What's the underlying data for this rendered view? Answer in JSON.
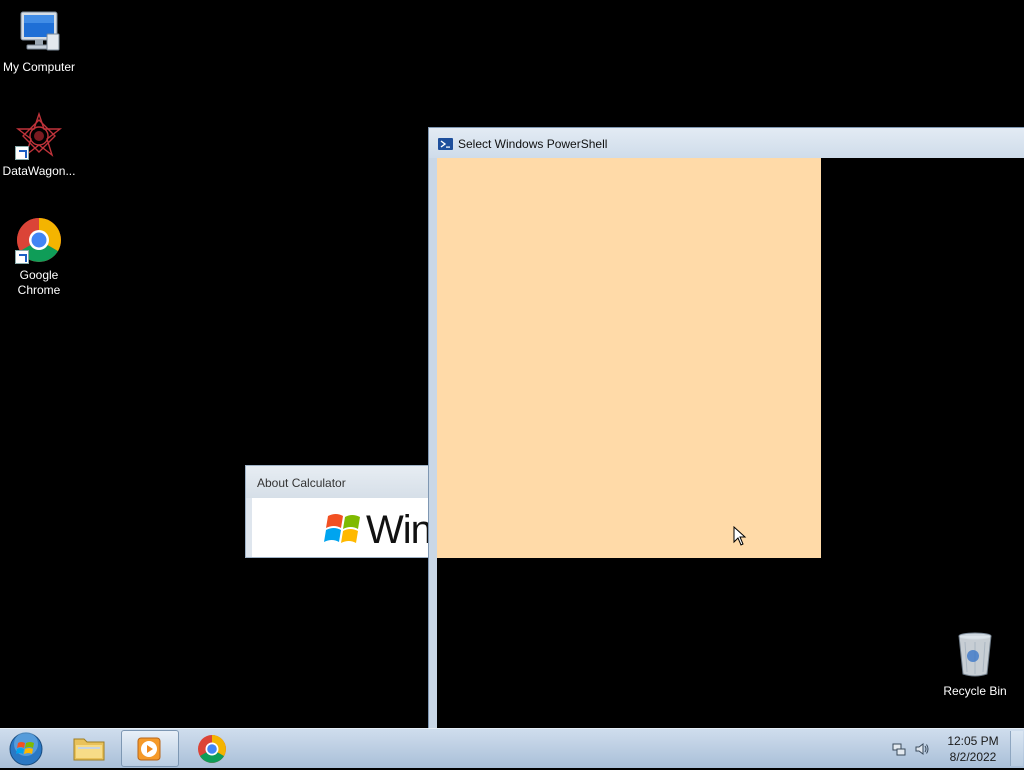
{
  "desktop": {
    "icons": [
      {
        "label": "My Computer",
        "icon": "computer-icon"
      },
      {
        "label": "DataWagon...",
        "icon": "datawagon-icon"
      },
      {
        "label": "Google Chrome",
        "icon": "chrome-icon"
      }
    ],
    "recycle_bin": {
      "label": "Recycle Bin",
      "icon": "recycle-bin-icon"
    }
  },
  "about_window": {
    "title": "About Calculator",
    "logo_text": "Win"
  },
  "powershell_window": {
    "title": "Select Windows PowerShell",
    "selection_color": "#ffdaa8"
  },
  "taskbar": {
    "items": [
      {
        "name": "start-button",
        "icon": "windows-orb-icon"
      },
      {
        "name": "explorer",
        "icon": "folder-icon"
      },
      {
        "name": "media-player",
        "icon": "media-player-icon",
        "active": true
      },
      {
        "name": "chrome",
        "icon": "chrome-icon"
      }
    ],
    "tray": [
      "network-icon",
      "speaker-icon"
    ],
    "clock": {
      "time": "12:05 PM",
      "date": "8/2/2022"
    }
  },
  "colors": {
    "desktop_bg": "#000000",
    "taskbar_top": "#cfdded",
    "taskbar_bottom": "#a9bfd8"
  }
}
